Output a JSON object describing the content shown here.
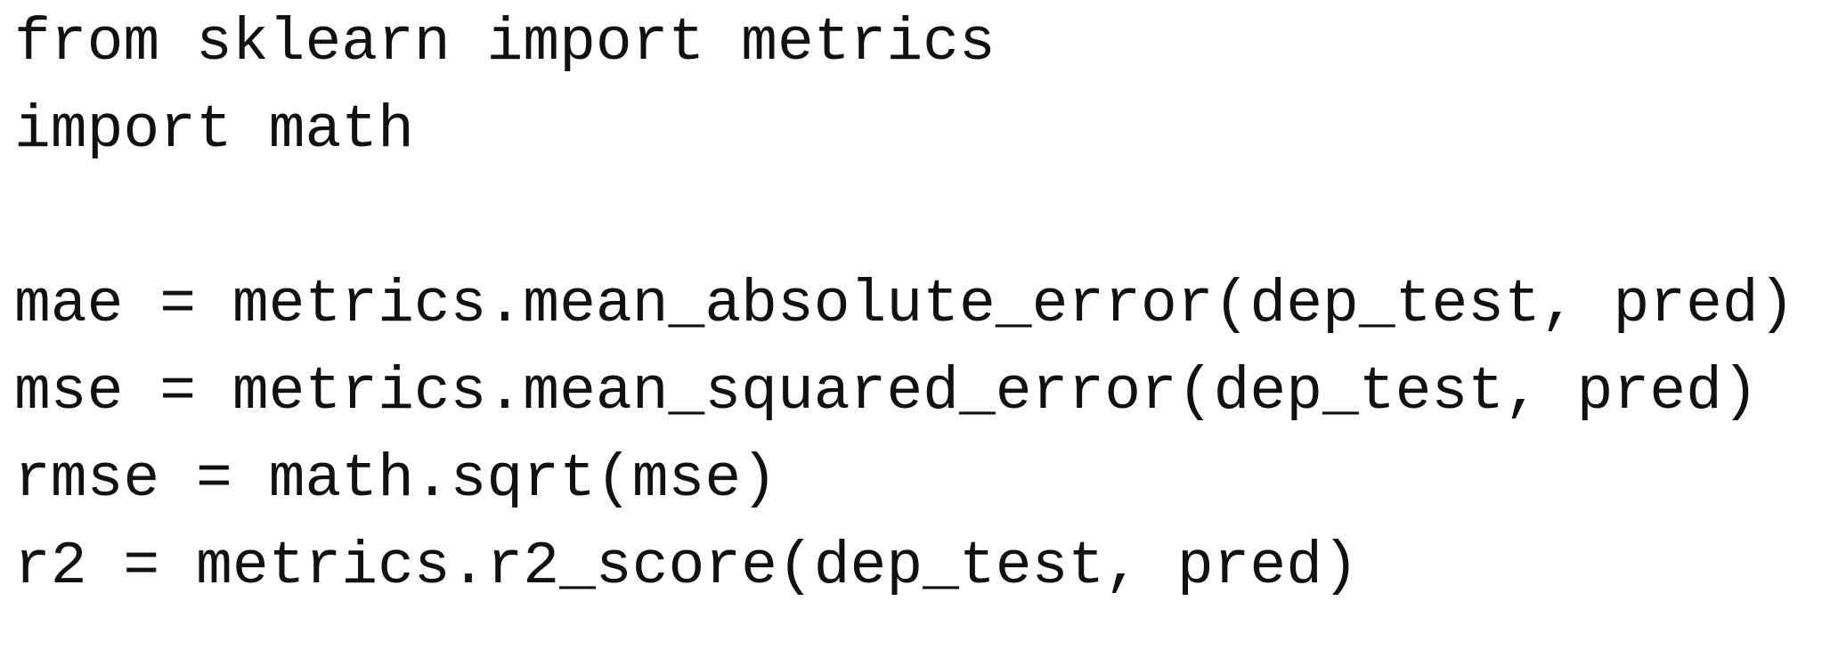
{
  "code": {
    "lines": [
      "from sklearn import metrics",
      "import math",
      "",
      "mae = metrics.mean_absolute_error(dep_test, pred)",
      "mse = metrics.mean_squared_error(dep_test, pred)",
      "rmse = math.sqrt(mse)",
      "r2 = metrics.r2_score(dep_test, pred)"
    ]
  }
}
